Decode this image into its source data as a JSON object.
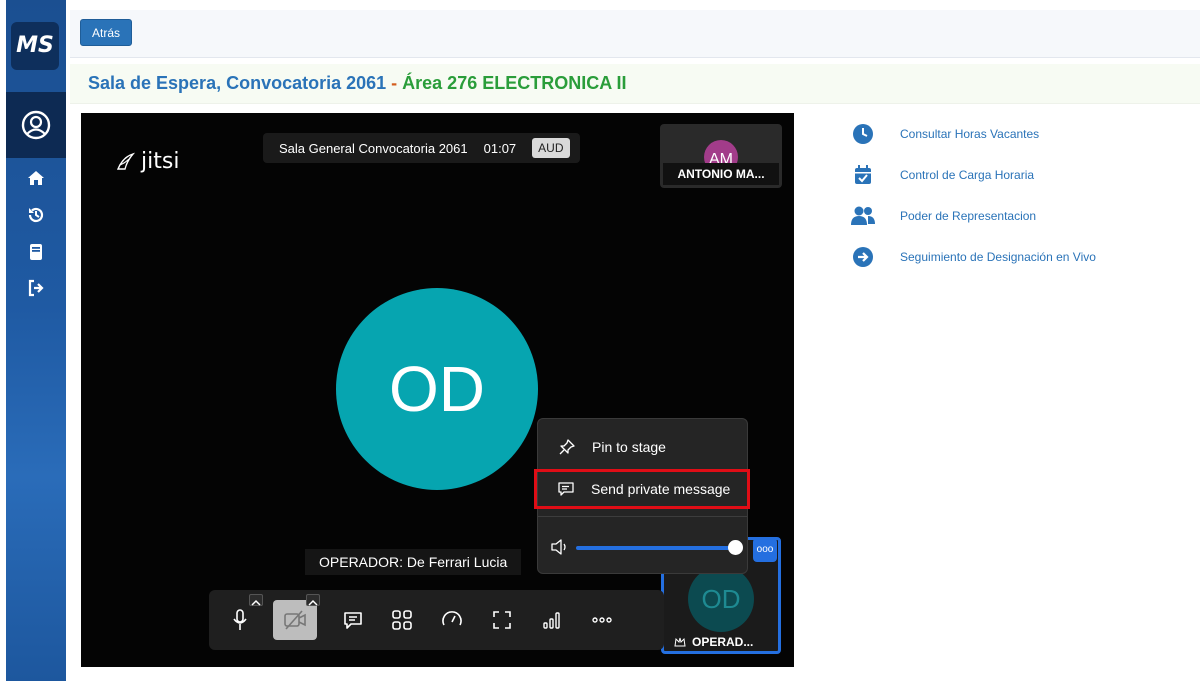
{
  "sidebar": {
    "logo_text": "MS",
    "brand_color": "#1b4f91"
  },
  "topbar": {
    "back_label": "Atrás"
  },
  "header": {
    "title_blue": "Sala de Espera, Convocatoria 2061",
    "separator": " - ",
    "title_green": "Área 276 ELECTRONICA II"
  },
  "meeting": {
    "logo_text": "jitsi",
    "room_name": "Sala General Convocatoria 2061",
    "timer": "01:07",
    "badge": "AUD",
    "remote_initials": "AM",
    "remote_name": "ANTONIO MA...",
    "main_initials": "OD",
    "speaker_label": "OPERADOR: De Ferrari Lucia",
    "local_initials": "OD",
    "local_name": "OPERAD...",
    "more_dots": "ooo"
  },
  "context_menu": {
    "items": [
      "Pin to stage",
      "Send private message"
    ],
    "volume": 1.0
  },
  "quick_links": [
    {
      "label": "Consultar Horas Vacantes",
      "icon": "clock-icon"
    },
    {
      "label": "Control de Carga Horaria",
      "icon": "calendar-check-icon"
    },
    {
      "label": "Poder de Representacion",
      "icon": "users-icon"
    },
    {
      "label": "Seguimiento de Designación en Vivo",
      "icon": "arrow-circle-icon"
    }
  ],
  "colors": {
    "accent": "#2a73b8",
    "green": "#2a9d3a",
    "teal": "#06a5b0",
    "highlight": "#e00d16"
  }
}
